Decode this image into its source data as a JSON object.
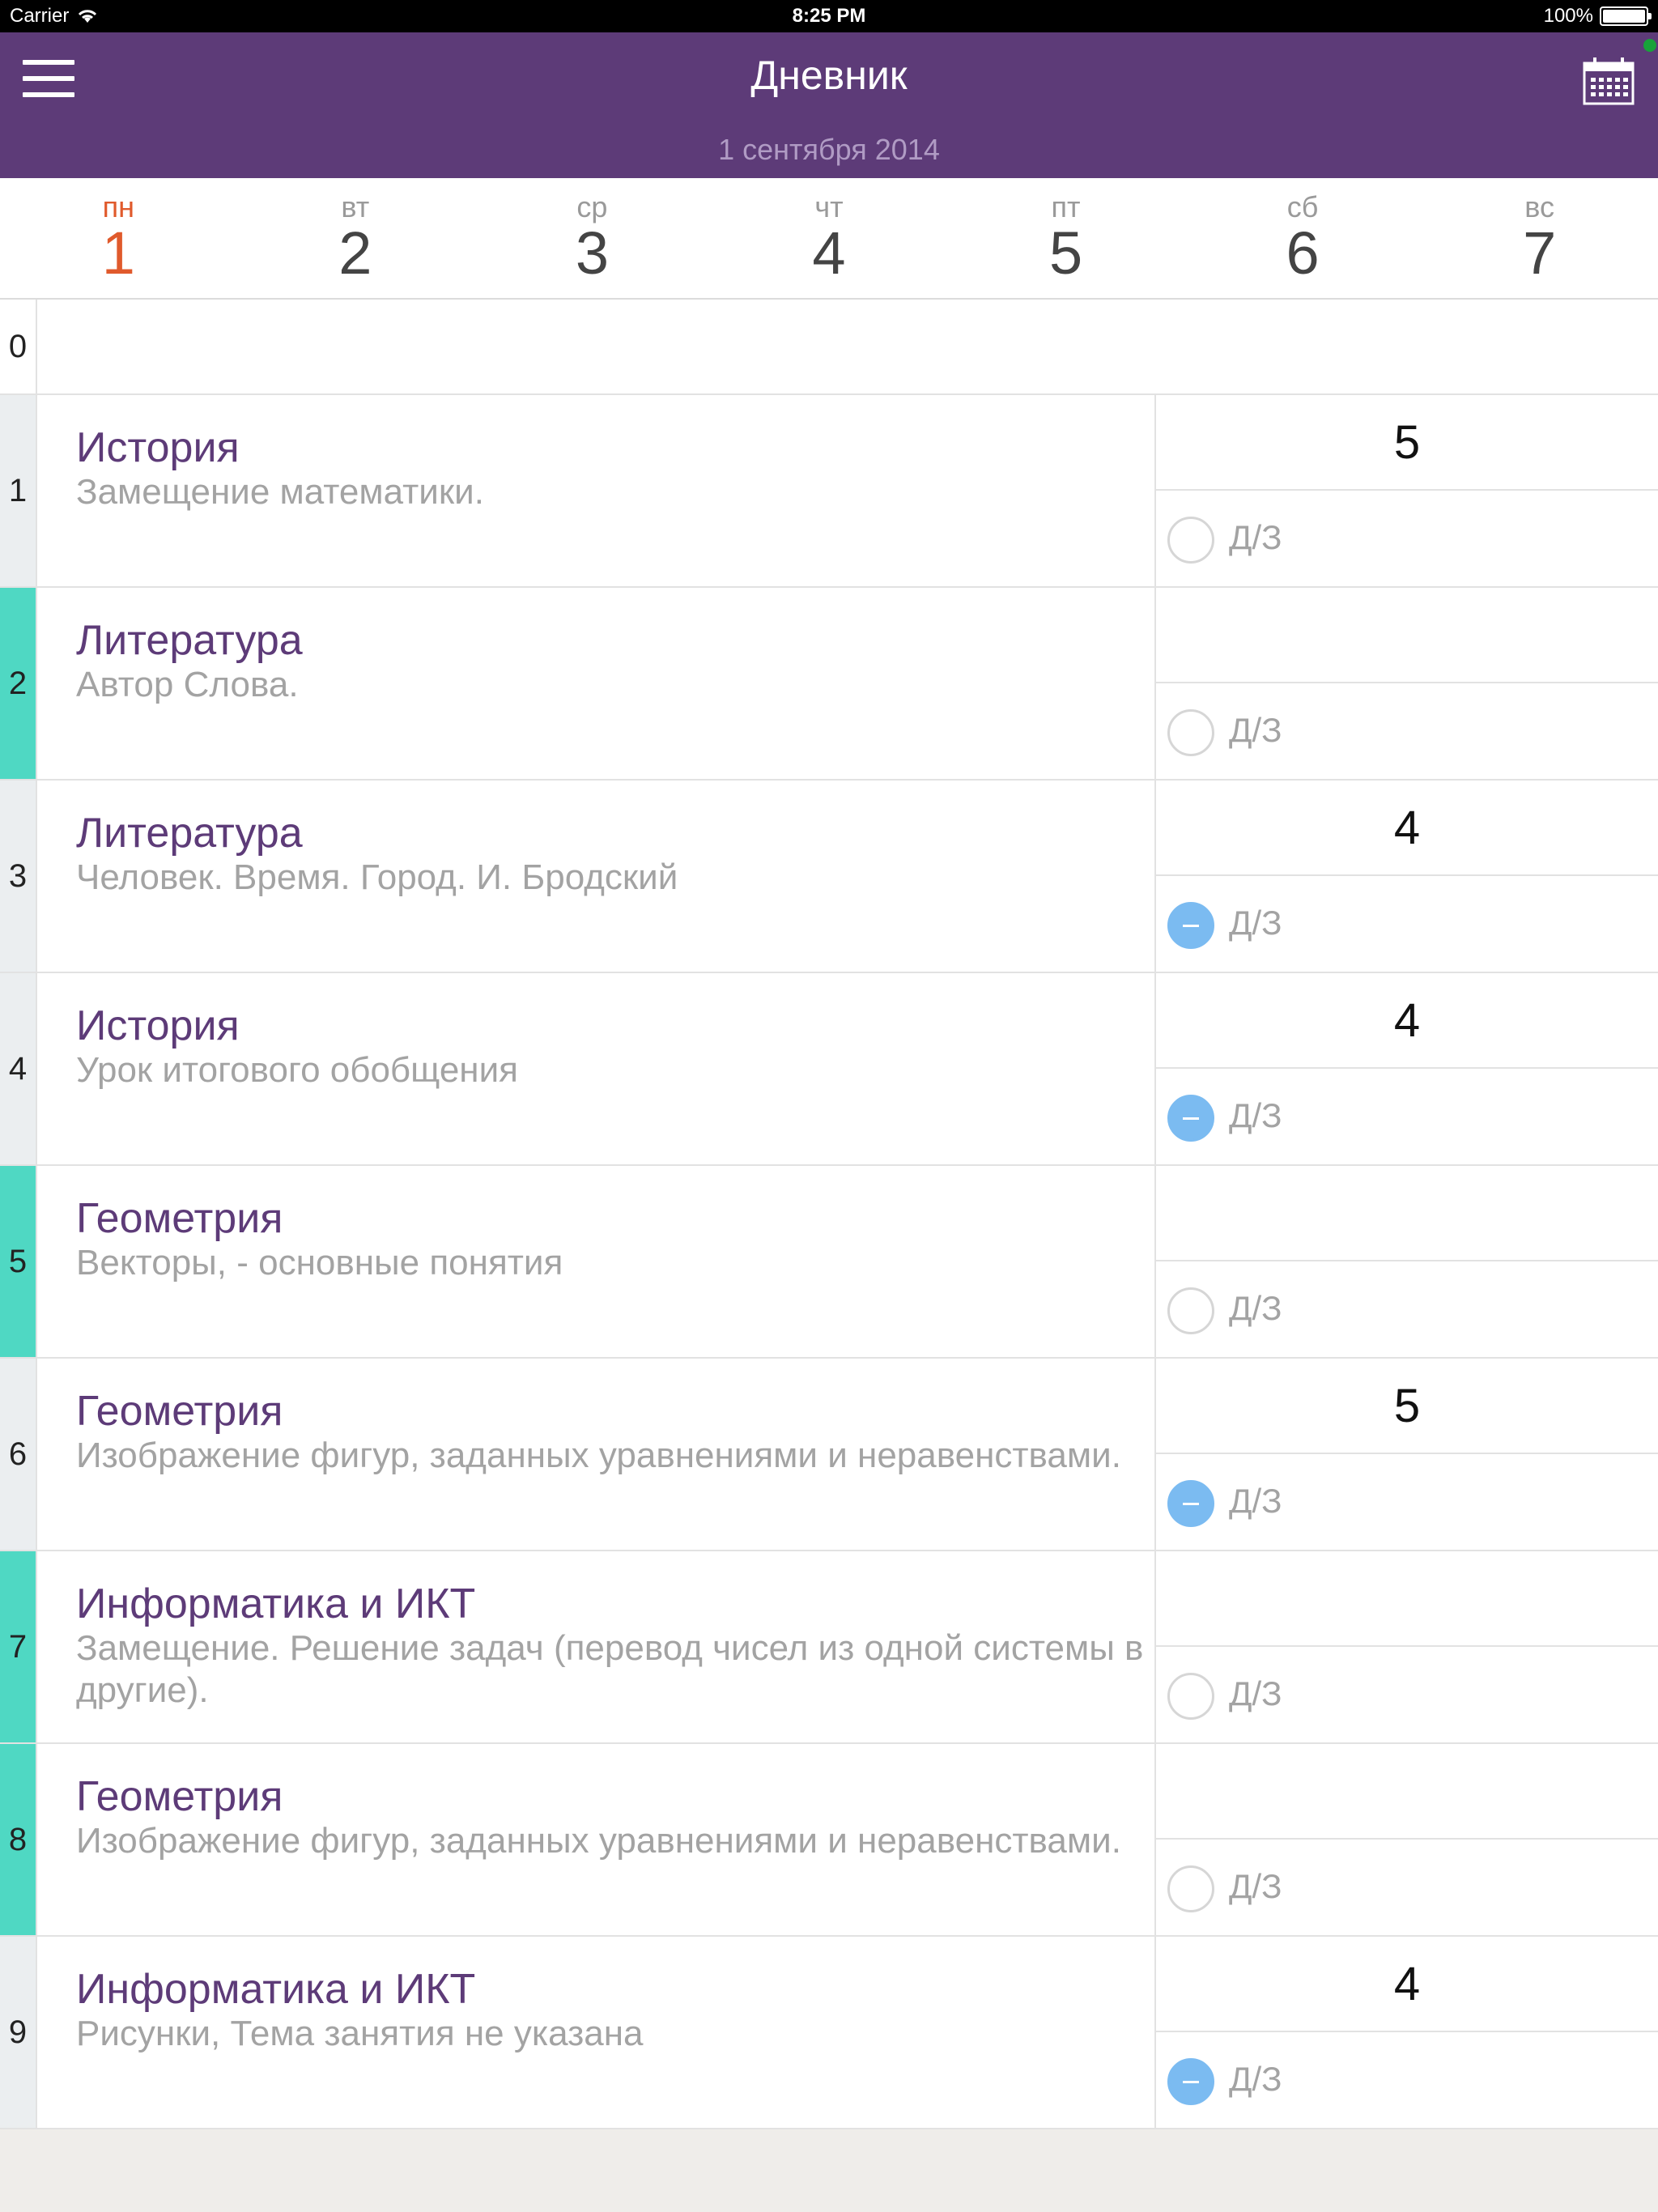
{
  "status_bar": {
    "carrier": "Carrier",
    "time": "8:25 PM",
    "battery": "100%"
  },
  "header": {
    "title": "Дневник",
    "date": "1 сентября 2014",
    "menu_icon": "hamburger-icon",
    "calendar_icon": "calendar-icon"
  },
  "colors": {
    "header": "#5d3b78",
    "accent": "#e05a2c",
    "teal": "#4fd8c3",
    "done": "#7bbbf1"
  },
  "week": [
    {
      "dow": "пн",
      "num": "1",
      "active": true
    },
    {
      "dow": "вт",
      "num": "2"
    },
    {
      "dow": "ср",
      "num": "3"
    },
    {
      "dow": "чт",
      "num": "4"
    },
    {
      "dow": "пт",
      "num": "5"
    },
    {
      "dow": "сб",
      "num": "6"
    },
    {
      "dow": "вс",
      "num": "7"
    }
  ],
  "zero_row": {
    "index": "0"
  },
  "hw_label": "Д/З",
  "lessons": [
    {
      "index": "1",
      "subject": "История",
      "topic": "Замещение математики.",
      "grade": "5",
      "hw_done": false,
      "teal": false
    },
    {
      "index": "2",
      "subject": "Литература",
      "topic": "Автор Слова.",
      "grade": "",
      "hw_done": false,
      "teal": true
    },
    {
      "index": "3",
      "subject": "Литература",
      "topic": "Человек. Время. Город. И. Бродский",
      "grade": "4",
      "hw_done": true,
      "teal": false
    },
    {
      "index": "4",
      "subject": "История",
      "topic": "Урок  итогового обобщения",
      "grade": "4",
      "hw_done": true,
      "teal": false
    },
    {
      "index": "5",
      "subject": "Геометрия",
      "topic": "Векторы, - основные понятия",
      "grade": "",
      "hw_done": false,
      "teal": true
    },
    {
      "index": "6",
      "subject": "Геометрия",
      "topic": "Изображение фигур, заданных уравнениями и неравенствами.",
      "grade": "5",
      "hw_done": true,
      "teal": false
    },
    {
      "index": "7",
      "subject": "Информатика и ИКТ",
      "topic": "Замещение. Решение задач (перевод чисел из одной системы в другие).",
      "grade": "",
      "hw_done": false,
      "teal": true
    },
    {
      "index": "8",
      "subject": "Геометрия",
      "topic": "Изображение фигур, заданных уравнениями и неравенствами.",
      "grade": "",
      "hw_done": false,
      "teal": true
    },
    {
      "index": "9",
      "subject": "Информатика и ИКТ",
      "topic": "Рисунки, Тема занятия не указана",
      "grade": "4",
      "hw_done": true,
      "teal": false
    }
  ]
}
